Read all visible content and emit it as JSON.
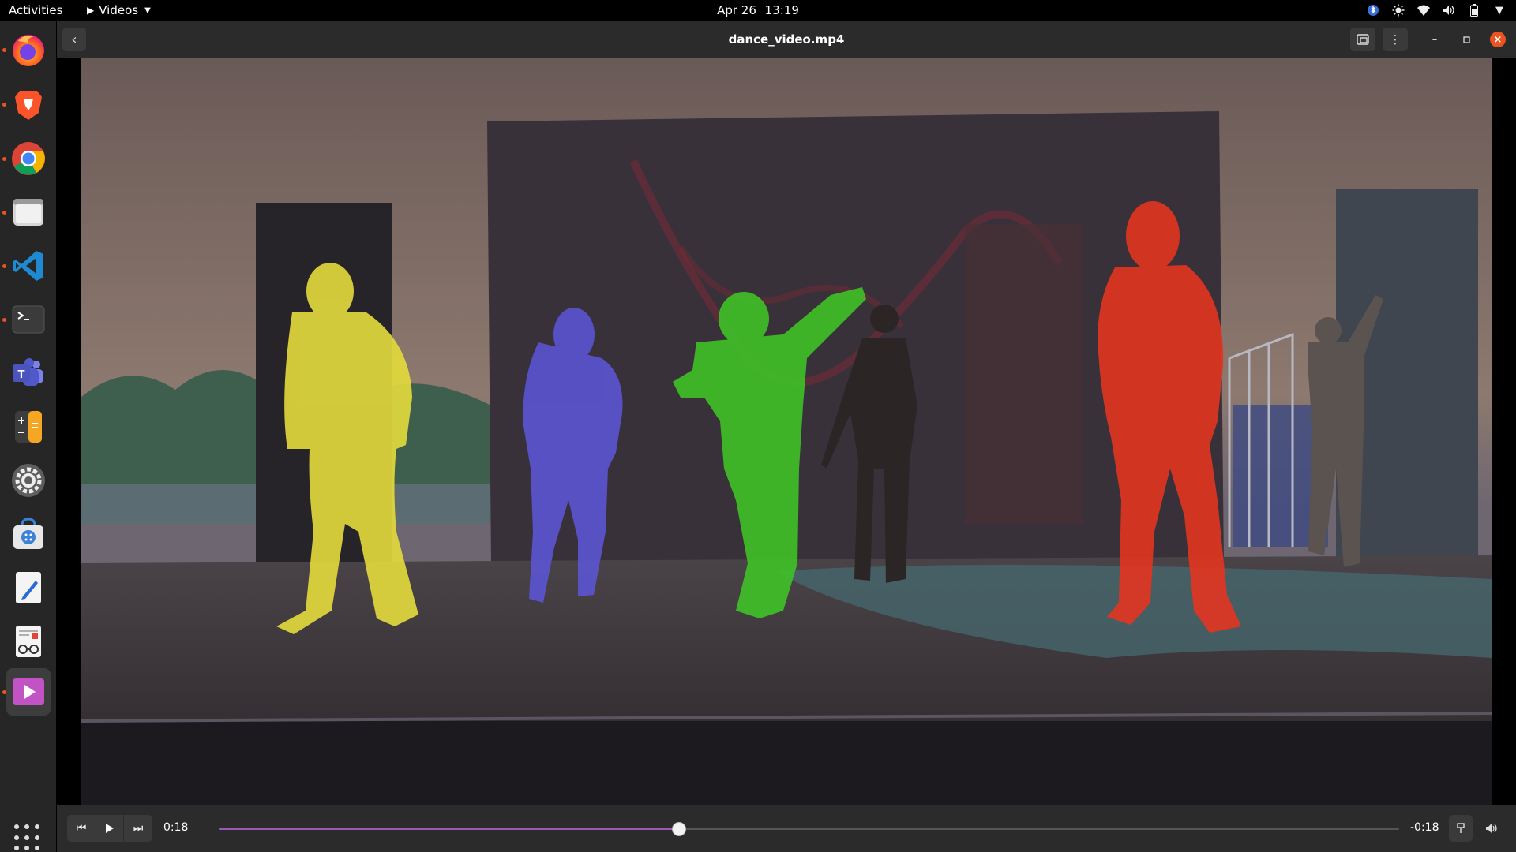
{
  "topbar": {
    "activities": "Activities",
    "app_name": "Videos",
    "date": "Apr 26",
    "time": "13:19",
    "tray_icons": [
      "bluetooth-icon",
      "brightness-icon",
      "wifi-icon",
      "volume-icon",
      "battery-icon",
      "system-menu-icon"
    ]
  },
  "dock": {
    "items": [
      "firefox",
      "brave",
      "chrome",
      "files",
      "vscode",
      "terminal",
      "teams",
      "calculator",
      "settings",
      "software-center",
      "text-editor",
      "document-viewer",
      "videos"
    ],
    "running_dots": [
      "firefox",
      "brave",
      "chrome",
      "files",
      "vscode",
      "terminal",
      "videos"
    ],
    "active": "videos"
  },
  "window": {
    "title": "dance_video.mp4"
  },
  "player": {
    "elapsed": "0:18",
    "remaining": "-0:18",
    "progress": 0.39,
    "accent": "#9b59b6"
  },
  "video_overlay": {
    "mask_colors": [
      "#e4dc3c",
      "#5b55d6",
      "#3fc227",
      "#e2351f"
    ]
  }
}
